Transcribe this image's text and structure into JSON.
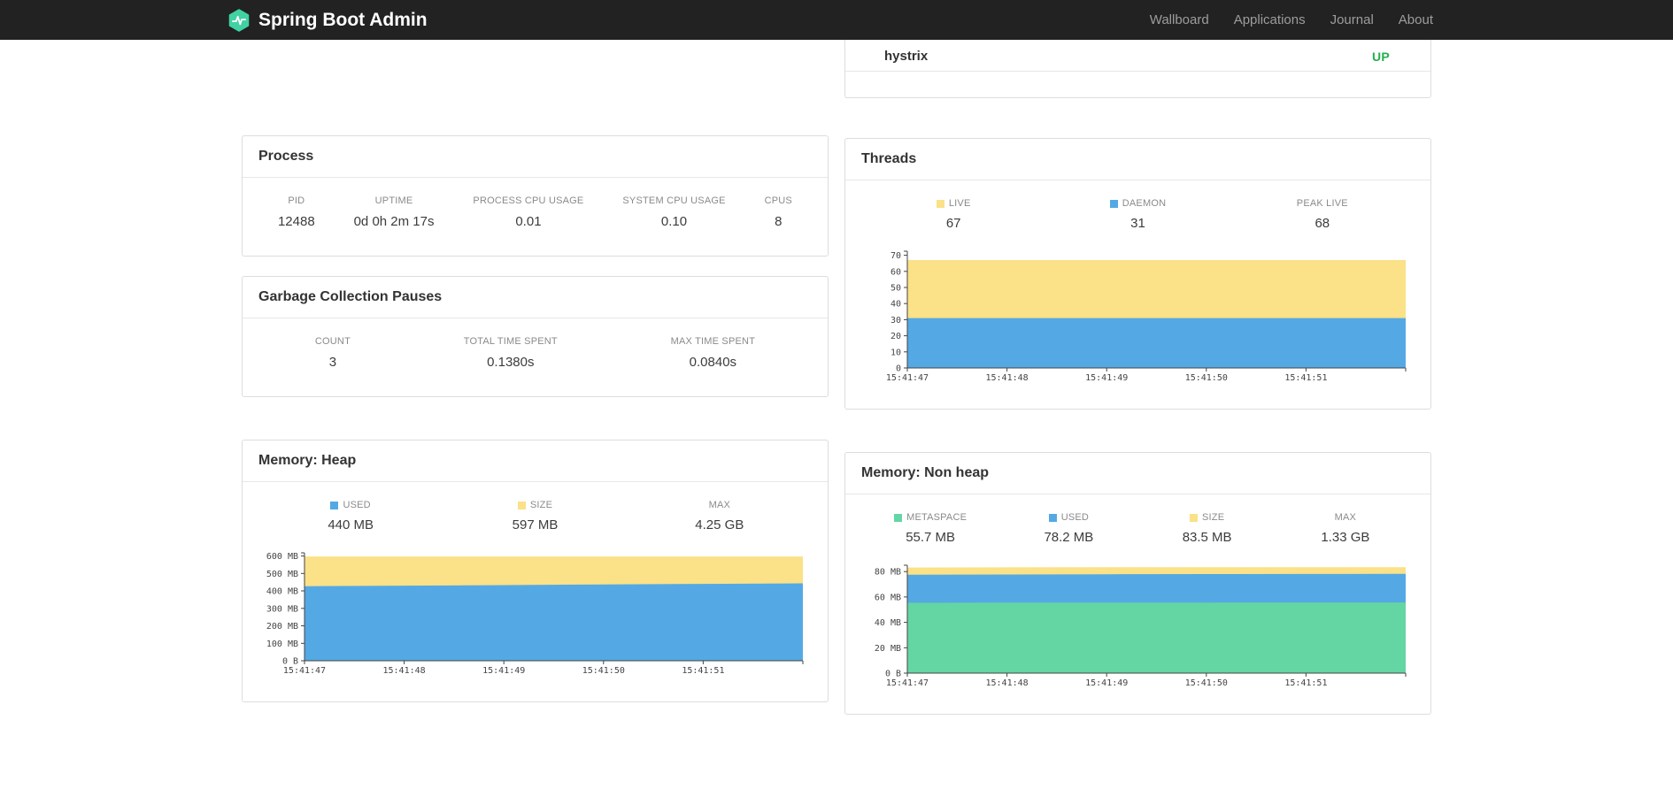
{
  "navbar": {
    "brand": "Spring Boot Admin",
    "logo_color": "#41d2a3",
    "links": [
      {
        "label": "Wallboard"
      },
      {
        "label": "Applications"
      },
      {
        "label": "Journal"
      },
      {
        "label": "About"
      }
    ]
  },
  "health_card": {
    "service": "hystrix",
    "status": "UP",
    "status_color": "#23b14d"
  },
  "cards": {
    "process": {
      "title": "Process",
      "metrics": [
        {
          "label": "PID",
          "value": "12488"
        },
        {
          "label": "UPTIME",
          "value": "0d 0h 2m 17s"
        },
        {
          "label": "PROCESS CPU USAGE",
          "value": "0.01"
        },
        {
          "label": "SYSTEM CPU USAGE",
          "value": "0.10"
        },
        {
          "label": "CPUS",
          "value": "8"
        }
      ]
    },
    "gc": {
      "title": "Garbage Collection Pauses",
      "metrics": [
        {
          "label": "COUNT",
          "value": "3"
        },
        {
          "label": "TOTAL TIME SPENT",
          "value": "0.1380s"
        },
        {
          "label": "MAX TIME SPENT",
          "value": "0.0840s"
        }
      ]
    },
    "threads": {
      "title": "Threads"
    },
    "heap": {
      "title": "Memory: Heap"
    },
    "nonheap": {
      "title": "Memory: Non heap"
    }
  },
  "chart_data": [
    {
      "id": "threads",
      "type": "area",
      "title": "Threads",
      "x": [
        "15:41:47",
        "15:41:48",
        "15:41:49",
        "15:41:50",
        "15:41:51"
      ],
      "ylim": [
        0,
        72.5
      ],
      "ymax": 72.5,
      "grid": false,
      "yticks": [
        {
          "v": 70,
          "label": "70"
        },
        {
          "v": 60,
          "label": "60"
        },
        {
          "v": 50,
          "label": "50"
        },
        {
          "v": 40,
          "label": "40"
        },
        {
          "v": 30,
          "label": "30"
        },
        {
          "v": 20,
          "label": "20"
        },
        {
          "v": 10,
          "label": "10"
        },
        {
          "v": 0,
          "label": "0"
        }
      ],
      "series": [
        {
          "name": "LIVE",
          "color": "#fbe187",
          "values": [
            67,
            67,
            67,
            67,
            67,
            67
          ]
        },
        {
          "name": "DAEMON",
          "color": "#54a9e4",
          "values": [
            31,
            31,
            31,
            31,
            31,
            31
          ]
        }
      ],
      "legend": [
        {
          "label": "LIVE",
          "value": "67",
          "color": "#fbe187"
        },
        {
          "label": "DAEMON",
          "value": "31",
          "color": "#54a9e4"
        },
        {
          "label": "PEAK LIVE",
          "value": "68",
          "color": null
        }
      ]
    },
    {
      "id": "memory-heap",
      "type": "area",
      "title": "Memory: Heap",
      "x": [
        "15:41:47",
        "15:41:48",
        "15:41:49",
        "15:41:50",
        "15:41:51"
      ],
      "ylim": [
        0,
        618
      ],
      "ymax": 618,
      "grid": false,
      "yticks": [
        {
          "v": 600,
          "label": "600 MB"
        },
        {
          "v": 500,
          "label": "500 MB"
        },
        {
          "v": 400,
          "label": "400 MB"
        },
        {
          "v": 300,
          "label": "300 MB"
        },
        {
          "v": 200,
          "label": "200 MB"
        },
        {
          "v": 100,
          "label": "100 MB"
        },
        {
          "v": 0,
          "label": "0 B"
        }
      ],
      "series": [
        {
          "name": "USED",
          "color": "#54a9e4",
          "values": [
            427,
            430,
            433,
            437,
            440,
            443
          ]
        },
        {
          "name": "SIZE",
          "color": "#fbe187",
          "values": [
            597,
            597,
            597,
            597,
            597,
            597
          ]
        }
      ],
      "legend": [
        {
          "label": "USED",
          "value": "440 MB",
          "color": "#54a9e4"
        },
        {
          "label": "SIZE",
          "value": "597 MB",
          "color": "#fbe187"
        },
        {
          "label": "MAX",
          "value": "4.25 GB",
          "color": null
        }
      ]
    },
    {
      "id": "memory-nonheap",
      "type": "area",
      "title": "Memory: Non heap",
      "x": [
        "15:41:47",
        "15:41:48",
        "15:41:49",
        "15:41:50",
        "15:41:51"
      ],
      "ylim": [
        0,
        85
      ],
      "ymax": 85,
      "grid": false,
      "yticks": [
        {
          "v": 80,
          "label": "80 MB"
        },
        {
          "v": 60,
          "label": "60 MB"
        },
        {
          "v": 40,
          "label": "40 MB"
        },
        {
          "v": 20,
          "label": "20 MB"
        },
        {
          "v": 0,
          "label": "0 B"
        }
      ],
      "series": [
        {
          "name": "METASPACE",
          "color": "#63d6a4",
          "values": [
            55.4,
            55.5,
            55.6,
            55.6,
            55.7,
            55.7
          ]
        },
        {
          "name": "USED",
          "color": "#54a9e4",
          "values": [
            77.5,
            77.7,
            77.9,
            78.0,
            78.1,
            78.2
          ]
        },
        {
          "name": "SIZE",
          "color": "#fbe187",
          "values": [
            83.2,
            83.3,
            83.4,
            83.4,
            83.5,
            83.5
          ]
        }
      ],
      "legend": [
        {
          "label": "METASPACE",
          "value": "55.7 MB",
          "color": "#63d6a4"
        },
        {
          "label": "USED",
          "value": "78.2 MB",
          "color": "#54a9e4"
        },
        {
          "label": "SIZE",
          "value": "83.5 MB",
          "color": "#fbe187"
        },
        {
          "label": "MAX",
          "value": "1.33 GB",
          "color": null
        }
      ]
    }
  ]
}
